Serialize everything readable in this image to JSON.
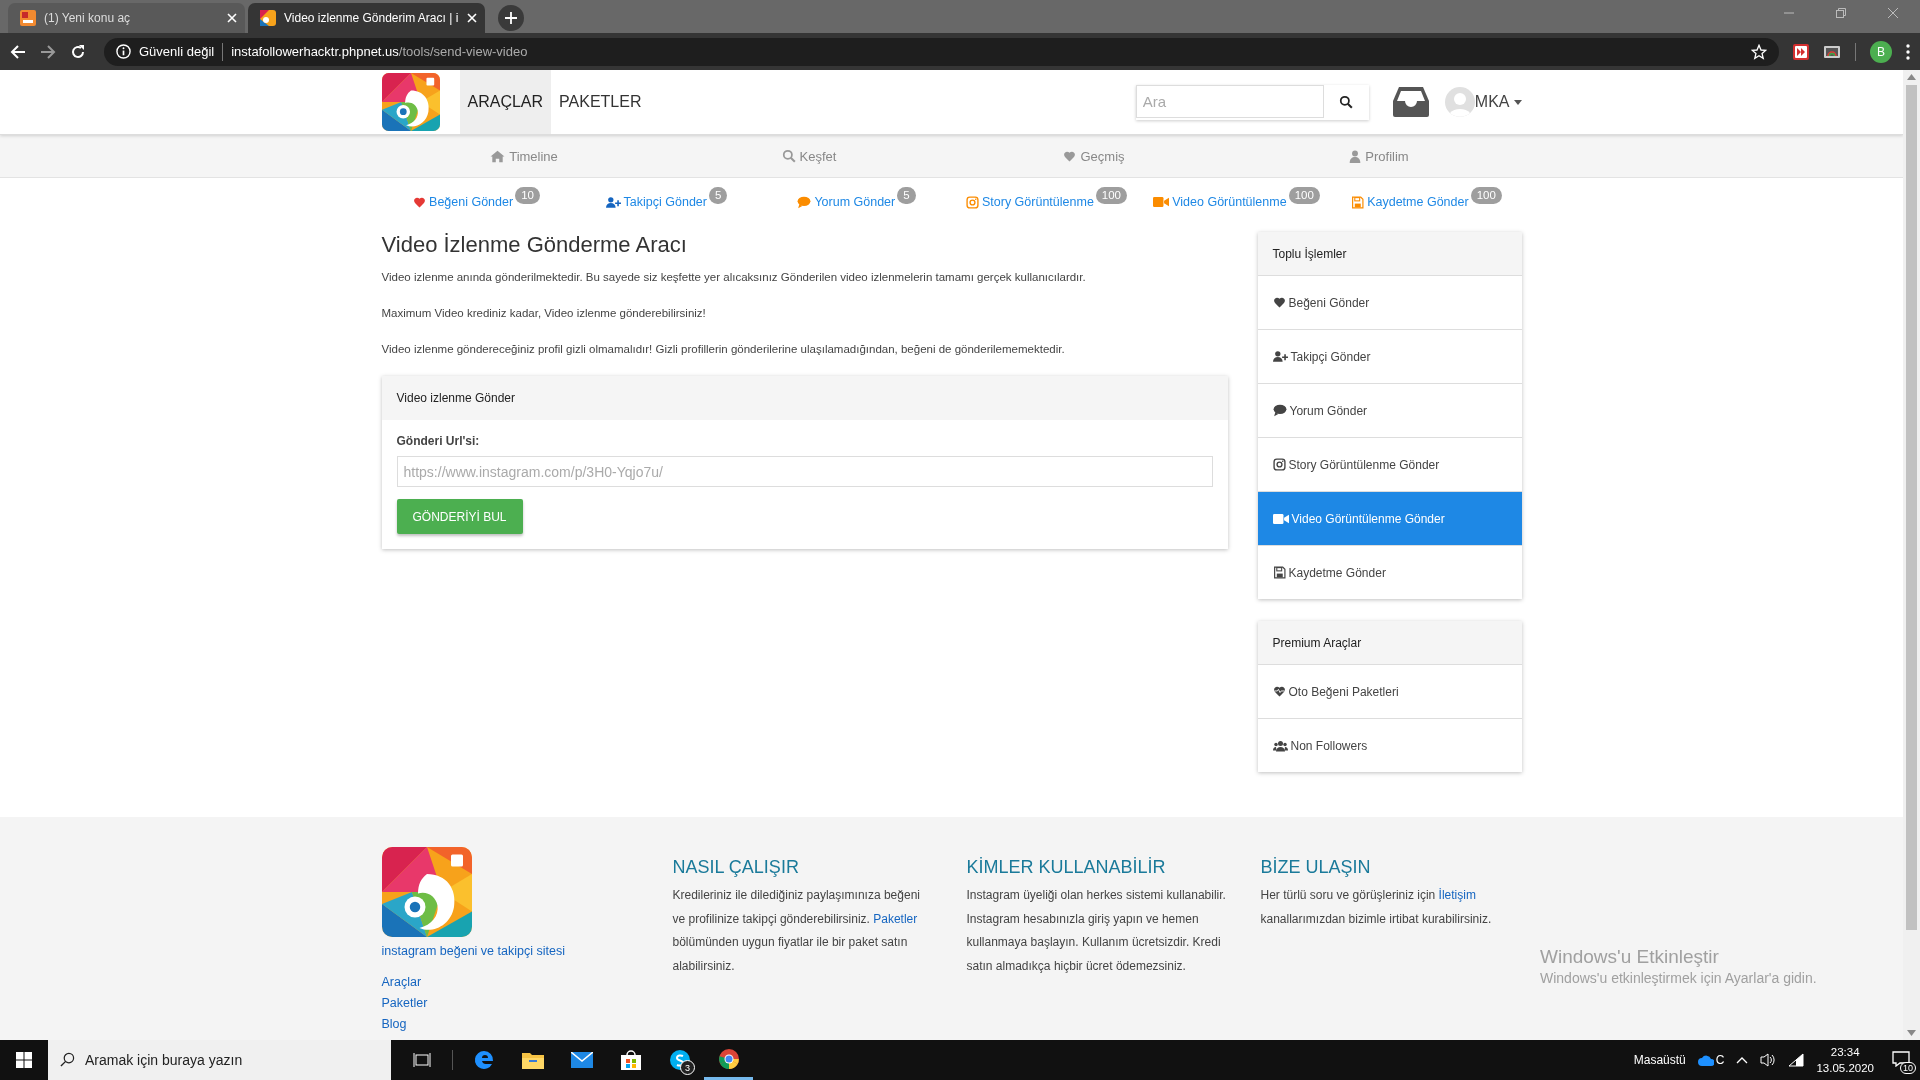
{
  "browser": {
    "tabs": [
      {
        "title": "(1) Yeni konu aç",
        "selected": false
      },
      {
        "title": "Video izlenme Gönderim Aracı | i",
        "selected": true
      }
    ],
    "security": "Güvenli değil",
    "url_host": "instafollowerhacktr.phpnet.us",
    "url_path": "/tools/send-view-video",
    "profile_initial": "B"
  },
  "header": {
    "nav": [
      {
        "label": "ARAÇLAR",
        "selected": true
      },
      {
        "label": "PAKETLER",
        "selected": false
      }
    ],
    "search": {
      "placeholder": "Ara"
    },
    "user": "MKA"
  },
  "subnav": [
    {
      "label": "Timeline"
    },
    {
      "label": "Keşfet"
    },
    {
      "label": "Geçmiş"
    },
    {
      "label": "Profilim"
    }
  ],
  "tools": [
    {
      "label": "Beğeni Gönder",
      "count": "10"
    },
    {
      "label": "Takipçi Gönder",
      "count": "5"
    },
    {
      "label": "Yorum Gönder",
      "count": "5"
    },
    {
      "label": "Story Görüntülenme",
      "count": "100"
    },
    {
      "label": "Video Görüntülenme",
      "count": "100"
    },
    {
      "label": "Kaydetme Gönder",
      "count": "100"
    }
  ],
  "main": {
    "title": "Video İzlenme Gönderme Aracı",
    "paragraphs": [
      "Video izlenme anında gönderilmektedir. Bu sayede siz keşfette yer alıcaksınız Gönderilen video izlenmelerin tamamı gerçek kullanıcılardır.",
      "Maximum Video krediniz kadar, Video izlenme gönderebilirsiniz!",
      "Video izlenme göndereceğiniz profil gizli olmamalıdır! Gizli profillerin gönderilerine ulaşılamadığından, beğeni de gönderilememektedir."
    ],
    "card": {
      "title": "Video izlenme Gönder",
      "field_label": "Gönderi Url'si:",
      "placeholder": "https://www.instagram.com/p/3H0-Yqjo7u/",
      "button": "GÖNDERİYİ BUL"
    }
  },
  "sidebar": [
    {
      "title": "Toplu İşlemler",
      "items": [
        {
          "label": "Beğeni Gönder",
          "selected": false
        },
        {
          "label": "Takipçi Gönder",
          "selected": false
        },
        {
          "label": "Yorum Gönder",
          "selected": false
        },
        {
          "label": "Story Görüntülenme Gönder",
          "selected": false
        },
        {
          "label": "Video Görüntülenme Gönder",
          "selected": true
        },
        {
          "label": "Kaydetme Gönder",
          "selected": false
        }
      ]
    },
    {
      "title": "Premium Araçlar",
      "items": [
        {
          "label": "Oto Beğeni Paketleri",
          "selected": false
        },
        {
          "label": "Non Followers",
          "selected": false
        }
      ]
    }
  ],
  "footer": {
    "tagline": "instagram beğeni ve takipçi sitesi",
    "links": [
      "Araçlar",
      "Paketler",
      "Blog"
    ],
    "columns": [
      {
        "title": "NASIL ÇALIŞIR",
        "segments": [
          {
            "kind": "text",
            "text": "Kredileriniz ile dilediğiniz paylaşımınıza beğeni ve profilinize takipçi gönderebilirsiniz. "
          },
          {
            "kind": "link",
            "text": "Paketler"
          },
          {
            "kind": "text",
            "text": " bölümünden uygun fiyatlar ile bir paket satın alabilirsiniz."
          }
        ]
      },
      {
        "title": "KİMLER KULLANABİLİR",
        "segments": [
          {
            "kind": "text",
            "text": "Instagram üyeliği olan herkes sistemi kullanabilir. Instagram hesabınızla giriş yapın ve hemen kullanmaya başlayın. Kullanım ücretsizdir. Kredi satın almadıkça hiçbir ücret ödemezsiniz."
          }
        ]
      },
      {
        "title": "BİZE ULAŞIN",
        "segments": [
          {
            "kind": "text",
            "text": "Her türlü soru ve görüşleriniz için "
          },
          {
            "kind": "link",
            "text": "İletişim"
          },
          {
            "kind": "text",
            "text": " kanallarımızdan bizimle irtibat kurabilirsiniz."
          }
        ]
      }
    ]
  },
  "activation": {
    "title": "Windows'u Etkinleştir",
    "text": "Windows'u etkinleştirmek için Ayarlar'a gidin."
  },
  "taskbar": {
    "search": {
      "placeholder": "Aramak için buraya yazın"
    },
    "skype_badge": "3",
    "tray_label": "Masaüstü",
    "weather": "C",
    "time": "23:34",
    "date": "13.05.2020",
    "notifications": "10"
  }
}
